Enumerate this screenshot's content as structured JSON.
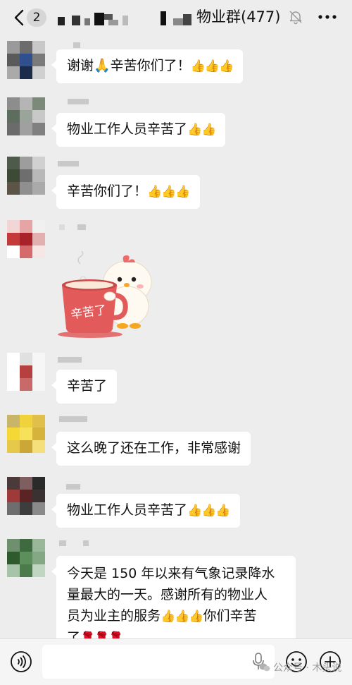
{
  "header": {
    "badge_count": "2",
    "group_title": "物业群(477)"
  },
  "messages": [
    {
      "text": "谢谢🙏辛苦你们了！",
      "emoji": "👍👍👍"
    },
    {
      "text": "物业工作人员辛苦了",
      "emoji": "👍👍"
    },
    {
      "text": "辛苦你们了！",
      "emoji": "👍👍👍"
    },
    {
      "sticker_text": "辛苦了"
    },
    {
      "text": "辛苦了"
    },
    {
      "text": "这么晚了还在工作，非常感谢"
    },
    {
      "text": "物业工作人员辛苦了",
      "emoji": "👍👍👍"
    },
    {
      "line1": "今天是 150 年以来有气象记录降水",
      "line2": "量最大的一天。感谢所有的物业人",
      "line3_text": "员为业主的服务",
      "line3_emoji": "👍👍👍",
      "line3_tail": "你们辛苦",
      "line4_text": "了",
      "line4_emoji": "🌹🌹🌹"
    }
  ],
  "watermark": "公众号 · 木头说",
  "icons": {
    "back": "chevron-left-icon",
    "bell": "bell-muted-icon",
    "more": "more-icon",
    "voice": "voice-icon",
    "mic": "microphone-icon",
    "emoji": "emoji-icon",
    "plus": "plus-icon"
  },
  "colors": {
    "background": "#ededed",
    "bubble": "#ffffff",
    "sticker_cup": "#e25a5a"
  }
}
